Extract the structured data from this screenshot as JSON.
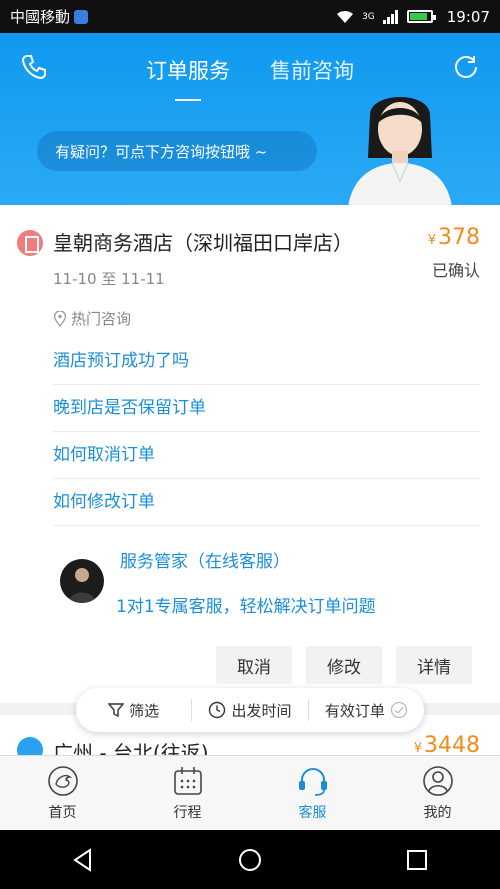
{
  "status_bar": {
    "carrier": "中國移動",
    "network": "3G",
    "time": "19:07"
  },
  "header": {
    "tabs": [
      {
        "label": "订单服务",
        "active": true
      },
      {
        "label": "售前咨询",
        "active": false
      }
    ],
    "prompt": "有疑问？可点下方咨询按钮哦 ~"
  },
  "order": {
    "hotel_name": "皇朝商务酒店（深圳福田口岸店）",
    "currency": "¥",
    "price": "378",
    "status": "已确认",
    "dates": "11-10 至 11-11",
    "hot_questions_label": "热门咨询",
    "faqs": [
      "酒店预订成功了吗",
      "晚到店是否保留订单",
      "如何取消订单",
      "如何修改订单"
    ],
    "butler_title": "服务管家（在线客服）",
    "butler_desc": "1对1专属客服，轻松解决订单问题",
    "actions": [
      "取消",
      "修改",
      "详情"
    ]
  },
  "next_order": {
    "title": "广州 - 台北(往返)",
    "currency": "¥",
    "price": "3448"
  },
  "filters": {
    "filter": "筛选",
    "departure_time": "出发时间",
    "valid_orders": "有效订单"
  },
  "bottom_nav": [
    {
      "label": "首页",
      "icon": "home-icon",
      "active": false
    },
    {
      "label": "行程",
      "icon": "calendar-icon",
      "active": false
    },
    {
      "label": "客服",
      "icon": "headset-icon",
      "active": true
    },
    {
      "label": "我的",
      "icon": "profile-icon",
      "active": false
    }
  ],
  "colors": {
    "header_blue": "#1aa0f2",
    "link_blue": "#1a8fd8",
    "price_orange": "#f08c1a"
  }
}
